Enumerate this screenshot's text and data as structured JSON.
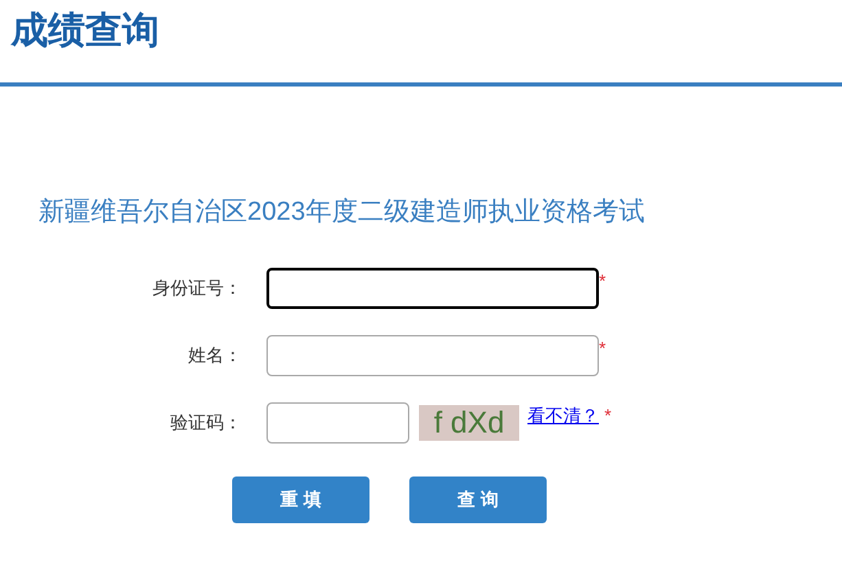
{
  "page_title": "成绩查询",
  "exam_title": "新疆维吾尔自治区2023年度二级建造师执业资格考试",
  "fields": [
    {
      "kind": "text",
      "label": "身份证号：",
      "focused": true,
      "required_mark": "*"
    },
    {
      "kind": "text",
      "label": "姓名：",
      "focused": false,
      "required_mark": "*"
    },
    {
      "kind": "captcha",
      "label": "验证码：",
      "focused": false,
      "captcha": "f dXd",
      "refresh_link": "看不清？",
      "required_mark": "*"
    }
  ],
  "buttons": [
    "重 填",
    "查 询"
  ]
}
